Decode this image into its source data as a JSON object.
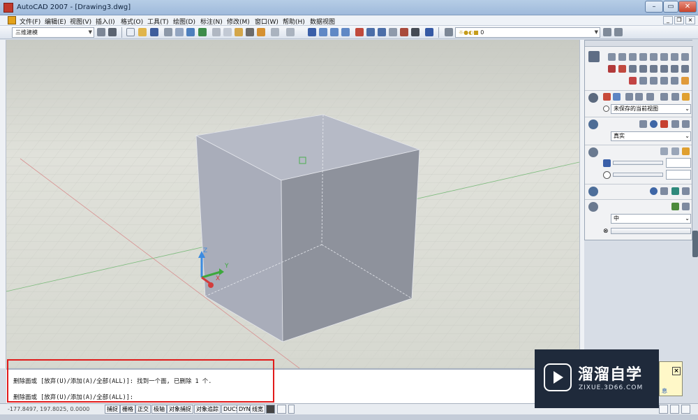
{
  "window": {
    "title": "AutoCAD 2007 - [Drawing3.dwg]"
  },
  "menu": {
    "items": [
      "文件(F)",
      "编辑(E)",
      "视图(V)",
      "插入(I)",
      "格式(O)",
      "工具(T)",
      "绘图(D)",
      "标注(N)",
      "修改(M)",
      "窗口(W)",
      "帮助(H)",
      "数据视图"
    ]
  },
  "toolbar": {
    "workspace": "三维建模",
    "layer_value": "0"
  },
  "viewport": {
    "ucs": {
      "z": "Z",
      "y": "Y",
      "x": "X"
    },
    "colors": {
      "cube_light": "#b5b9c5",
      "cube_dark": "#8f939d",
      "x_axis": "#d9534f",
      "y_axis": "#4cae4c"
    }
  },
  "palette": {
    "view_select": "未保存的当前视图",
    "visual_style": "真实",
    "material_quality": "中"
  },
  "command": {
    "line1": "删除面或 [放弃(U)/添加(A)/全部(ALL)]: 找到一个面, 已删除 1 个.",
    "line2": "删除面或 [放弃(U)/添加(A)/全部(ALL)]:"
  },
  "status": {
    "coords": "-177.8497, 197.8025, 0.0000",
    "buttons": [
      "捕捉",
      "栅格",
      "正交",
      "极轴",
      "对象捕捉",
      "对象追踪",
      "DUCS",
      "DYN",
      "线宽"
    ]
  },
  "watermark": {
    "brand": "溜溜自学",
    "url": "ZIXUE.3D66.COM"
  },
  "bubble": {
    "close": "×",
    "info": "息"
  }
}
